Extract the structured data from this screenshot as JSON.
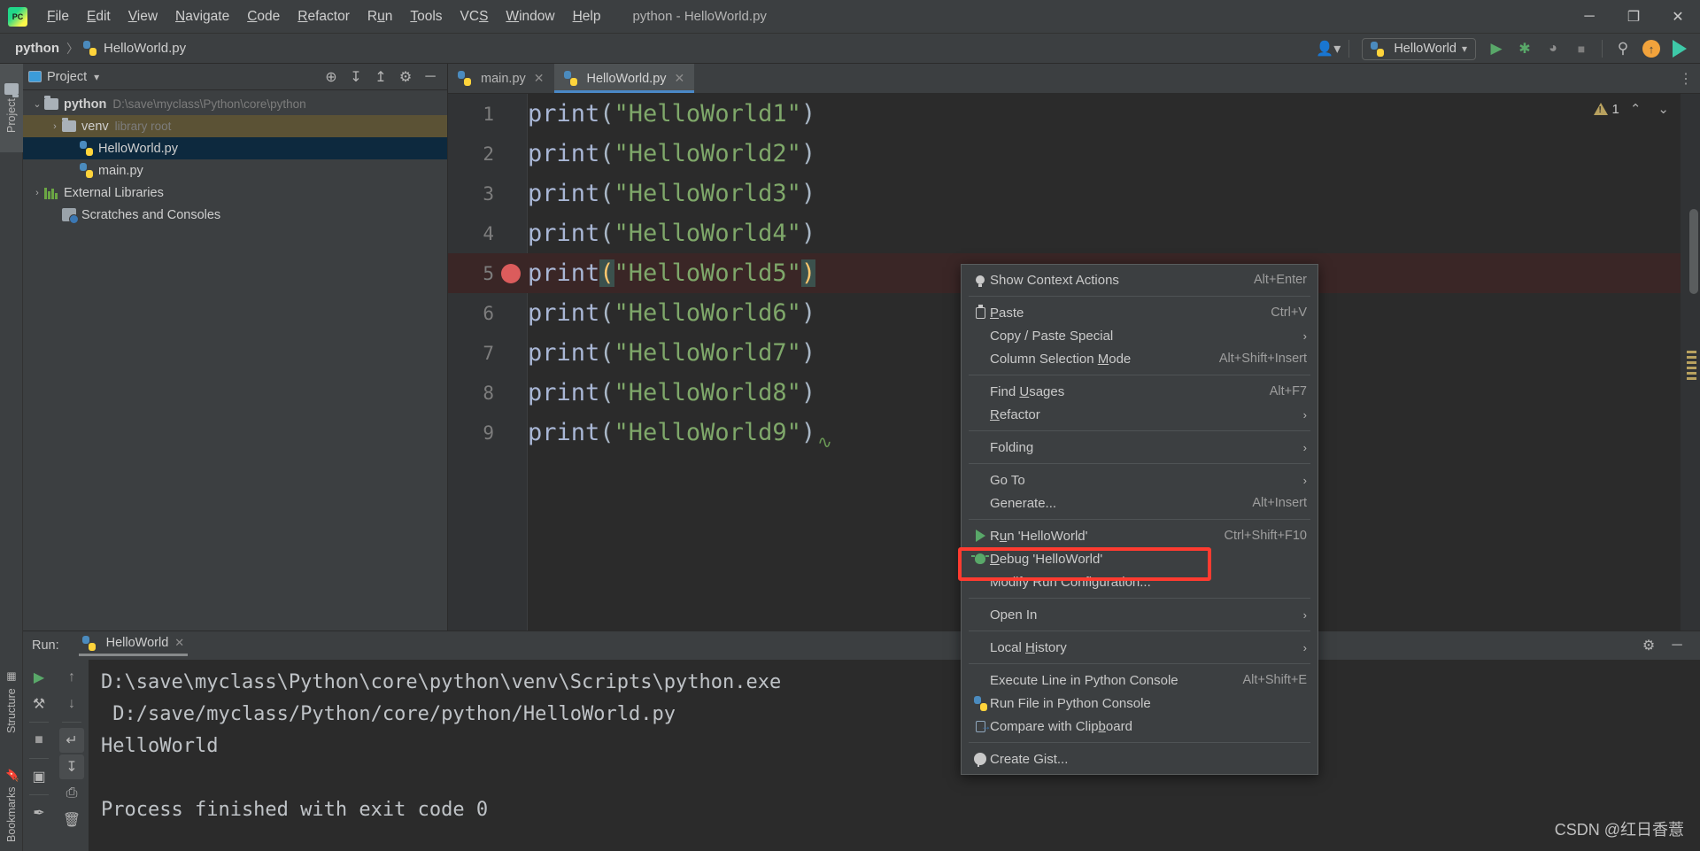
{
  "window": {
    "title": "python - HelloWorld.py",
    "logo": "pycharm-logo",
    "controls": {
      "minimize": "─",
      "maximize": "❐",
      "close": "✕"
    }
  },
  "menubar": {
    "items": [
      {
        "label": "File",
        "mnemonic": "F"
      },
      {
        "label": "Edit",
        "mnemonic": "E"
      },
      {
        "label": "View",
        "mnemonic": "V"
      },
      {
        "label": "Navigate",
        "mnemonic": "N"
      },
      {
        "label": "Code",
        "mnemonic": "C"
      },
      {
        "label": "Refactor",
        "mnemonic": "R"
      },
      {
        "label": "Run",
        "mnemonic": "u"
      },
      {
        "label": "Tools",
        "mnemonic": "T"
      },
      {
        "label": "VCS",
        "mnemonic": "S"
      },
      {
        "label": "Window",
        "mnemonic": "W"
      },
      {
        "label": "Help",
        "mnemonic": "H"
      }
    ]
  },
  "navbar": {
    "breadcrumbs": [
      "python",
      "HelloWorld.py"
    ],
    "separator": "〉",
    "run_configuration": "HelloWorld",
    "dropdown_caret": "▾",
    "buttons": [
      {
        "name": "run-button",
        "glyph": "▶",
        "color": "#59a869"
      },
      {
        "name": "debug-button",
        "glyph": "✱",
        "color": "#59a869"
      },
      {
        "name": "run-coverage-button",
        "glyph": "◑",
        "color": "#8e8e8e"
      },
      {
        "name": "stop-button",
        "glyph": "■",
        "color": "#7e7e7e"
      },
      {
        "name": "search-everywhere-button",
        "glyph": "⚲",
        "color": "#bdbdbd"
      },
      {
        "name": "updates-button",
        "glyph": "↑",
        "color": "#f2a33c"
      },
      {
        "name": "ide-assistant-button",
        "glyph": "▶",
        "color": "#3ec9a8"
      }
    ]
  },
  "left_strip": {
    "project_label": "Project",
    "structure_label": "Structure",
    "bookmarks_label": "Bookmarks"
  },
  "project_pane": {
    "title": "Project",
    "dropdown_caret": "▾",
    "actions": [
      {
        "name": "select-opened-file-icon",
        "glyph": "⊕"
      },
      {
        "name": "expand-all-icon",
        "glyph": "↧"
      },
      {
        "name": "collapse-all-icon",
        "glyph": "↥"
      },
      {
        "name": "settings-gear-icon",
        "glyph": "⚙"
      },
      {
        "name": "hide-icon",
        "glyph": "─"
      }
    ],
    "tree": [
      {
        "label": "python",
        "detail": "D:\\save\\myclass\\Python\\core\\python",
        "twisty": "⌄",
        "icon": "folder",
        "bold": true,
        "indent": 0,
        "state": "none"
      },
      {
        "label": "venv",
        "detail": "library root",
        "twisty": "›",
        "icon": "folder",
        "bold": false,
        "indent": 1,
        "state": "olive"
      },
      {
        "label": "HelloWorld.py",
        "detail": "",
        "twisty": "",
        "icon": "python-file",
        "bold": false,
        "indent": 2,
        "state": "blue"
      },
      {
        "label": "main.py",
        "detail": "",
        "twisty": "",
        "icon": "python-file",
        "bold": false,
        "indent": 2,
        "state": "none"
      },
      {
        "label": "External Libraries",
        "detail": "",
        "twisty": "›",
        "icon": "library",
        "bold": false,
        "indent": 0,
        "state": "none"
      },
      {
        "label": "Scratches and Consoles",
        "detail": "",
        "twisty": "",
        "icon": "scratch",
        "bold": false,
        "indent": 1,
        "state": "none"
      }
    ]
  },
  "editor_tabs": {
    "tabs": [
      {
        "label": "main.py",
        "active": false,
        "close": "✕"
      },
      {
        "label": "HelloWorld.py",
        "active": true,
        "close": "✕"
      }
    ],
    "overflow_glyph": "⋮"
  },
  "editor": {
    "lines": [
      {
        "num": "1",
        "fn": "print",
        "text": "\"HelloWorld1\"",
        "breakpoint": false,
        "highlight": false
      },
      {
        "num": "2",
        "fn": "print",
        "text": "\"HelloWorld2\"",
        "breakpoint": false,
        "highlight": false
      },
      {
        "num": "3",
        "fn": "print",
        "text": "\"HelloWorld3\"",
        "breakpoint": false,
        "highlight": false
      },
      {
        "num": "4",
        "fn": "print",
        "text": "\"HelloWorld4\"",
        "breakpoint": false,
        "highlight": false
      },
      {
        "num": "5",
        "fn": "print",
        "text": "\"HelloWorld5\"",
        "breakpoint": true,
        "highlight": true
      },
      {
        "num": "6",
        "fn": "print",
        "text": "\"HelloWorld6\"",
        "breakpoint": false,
        "highlight": false
      },
      {
        "num": "7",
        "fn": "print",
        "text": "\"HelloWorld7\"",
        "breakpoint": false,
        "highlight": false
      },
      {
        "num": "8",
        "fn": "print",
        "text": "\"HelloWorld8\"",
        "breakpoint": false,
        "highlight": false
      },
      {
        "num": "9",
        "fn": "print",
        "text": "\"HelloWorld9\"",
        "breakpoint": false,
        "highlight": false
      }
    ],
    "inspection_count": "1",
    "prev_highlight": "⌃",
    "next_highlight": "⌄"
  },
  "context_menu": {
    "highlighted_item": "Debug 'HelloWorld'",
    "items": [
      {
        "label": "Show Context Actions",
        "mnemonic": "",
        "shortcut": "Alt+Enter",
        "icon": "lightbulb-icon",
        "submenu": false
      },
      {
        "separator": true
      },
      {
        "label": "Paste",
        "mnemonic": "P",
        "shortcut": "Ctrl+V",
        "icon": "clipboard-icon",
        "submenu": false
      },
      {
        "label": "Copy / Paste Special",
        "mnemonic": "",
        "shortcut": "",
        "icon": "",
        "submenu": true
      },
      {
        "label": "Column Selection Mode",
        "mnemonic": "M",
        "shortcut": "Alt+Shift+Insert",
        "icon": "",
        "submenu": false
      },
      {
        "separator": true
      },
      {
        "label": "Find Usages",
        "mnemonic": "U",
        "shortcut": "Alt+F7",
        "icon": "",
        "submenu": false
      },
      {
        "label": "Refactor",
        "mnemonic": "R",
        "shortcut": "",
        "icon": "",
        "submenu": true
      },
      {
        "separator": true
      },
      {
        "label": "Folding",
        "mnemonic": "",
        "shortcut": "",
        "icon": "",
        "submenu": true
      },
      {
        "separator": true
      },
      {
        "label": "Go To",
        "mnemonic": "",
        "shortcut": "",
        "icon": "",
        "submenu": true
      },
      {
        "label": "Generate...",
        "mnemonic": "",
        "shortcut": "Alt+Insert",
        "icon": "",
        "submenu": false
      },
      {
        "separator": true
      },
      {
        "label": "Run 'HelloWorld'",
        "mnemonic": "u",
        "shortcut": "Ctrl+Shift+F10",
        "icon": "run-icon",
        "submenu": false
      },
      {
        "label": "Debug 'HelloWorld'",
        "mnemonic": "D",
        "shortcut": "",
        "icon": "debug-icon",
        "submenu": false
      },
      {
        "label": "Modify Run Configuration...",
        "mnemonic": "",
        "shortcut": "",
        "icon": "",
        "submenu": false
      },
      {
        "separator": true
      },
      {
        "label": "Open In",
        "mnemonic": "",
        "shortcut": "",
        "icon": "",
        "submenu": true
      },
      {
        "separator": true
      },
      {
        "label": "Local History",
        "mnemonic": "H",
        "shortcut": "",
        "icon": "",
        "submenu": true
      },
      {
        "separator": true
      },
      {
        "label": "Execute Line in Python Console",
        "mnemonic": "",
        "shortcut": "Alt+Shift+E",
        "icon": "",
        "submenu": false
      },
      {
        "label": "Run File in Python Console",
        "mnemonic": "",
        "shortcut": "",
        "icon": "python-icon",
        "submenu": false
      },
      {
        "label": "Compare with Clipboard",
        "mnemonic": "b",
        "shortcut": "",
        "icon": "compare-icon",
        "submenu": false
      },
      {
        "separator": true
      },
      {
        "label": "Create Gist...",
        "mnemonic": "",
        "shortcut": "",
        "icon": "github-icon",
        "submenu": false
      }
    ]
  },
  "run_pane": {
    "label": "Run:",
    "tab": "HelloWorld",
    "tab_close": "✕",
    "header_actions": [
      {
        "name": "run-settings-gear-icon",
        "glyph": "⚙"
      },
      {
        "name": "hide-run-panel-icon",
        "glyph": "─"
      }
    ],
    "left_tools": [
      {
        "name": "rerun-icon",
        "glyph": "▶",
        "color": "#59a869"
      },
      {
        "name": "edit-configuration-icon",
        "glyph": "⚒",
        "color": "#b6b6b6"
      },
      {
        "name": "stop-icon",
        "glyph": "■",
        "color": "#9a9a9a"
      },
      {
        "name": "layout-icon",
        "glyph": "▣",
        "color": "#b6b6b6"
      },
      {
        "name": "pin-icon",
        "glyph": "✒",
        "color": "#b6b6b6"
      }
    ],
    "secondary_tools": [
      {
        "name": "up-arrow-icon",
        "glyph": "↑",
        "color": "#9a9a9a"
      },
      {
        "name": "down-arrow-icon",
        "glyph": "↓",
        "color": "#9a9a9a"
      },
      {
        "name": "soft-wrap-icon",
        "glyph": "↵",
        "color": "#b6b6b6"
      },
      {
        "name": "scroll-to-end-icon",
        "glyph": "↧",
        "color": "#b6b6b6"
      },
      {
        "name": "print-icon",
        "glyph": "⎙",
        "color": "#b6b6b6"
      },
      {
        "name": "clear-all-icon",
        "glyph": "🗑",
        "color": "#b6b6b6"
      }
    ],
    "console_lines": [
      "D:\\save\\myclass\\Python\\core\\python\\venv\\Scripts\\python.exe",
      " D:/save/myclass/Python/core/python/HelloWorld.py",
      "HelloWorld",
      "",
      "Process finished with exit code 0"
    ]
  },
  "watermark": "CSDN @红日香薏",
  "colors": {
    "background": "#3c3f41",
    "editor_background": "#2b2b2b",
    "accent_blue": "#4a88c7",
    "selection_blue": "#0d293e",
    "selection_olive": "#5b5235",
    "highlight_red": "#ff3b30",
    "breakpoint_red": "#db5c5c",
    "string_green": "#7fa86a",
    "function_blue": "#a9b7d6",
    "run_green": "#59a869"
  }
}
